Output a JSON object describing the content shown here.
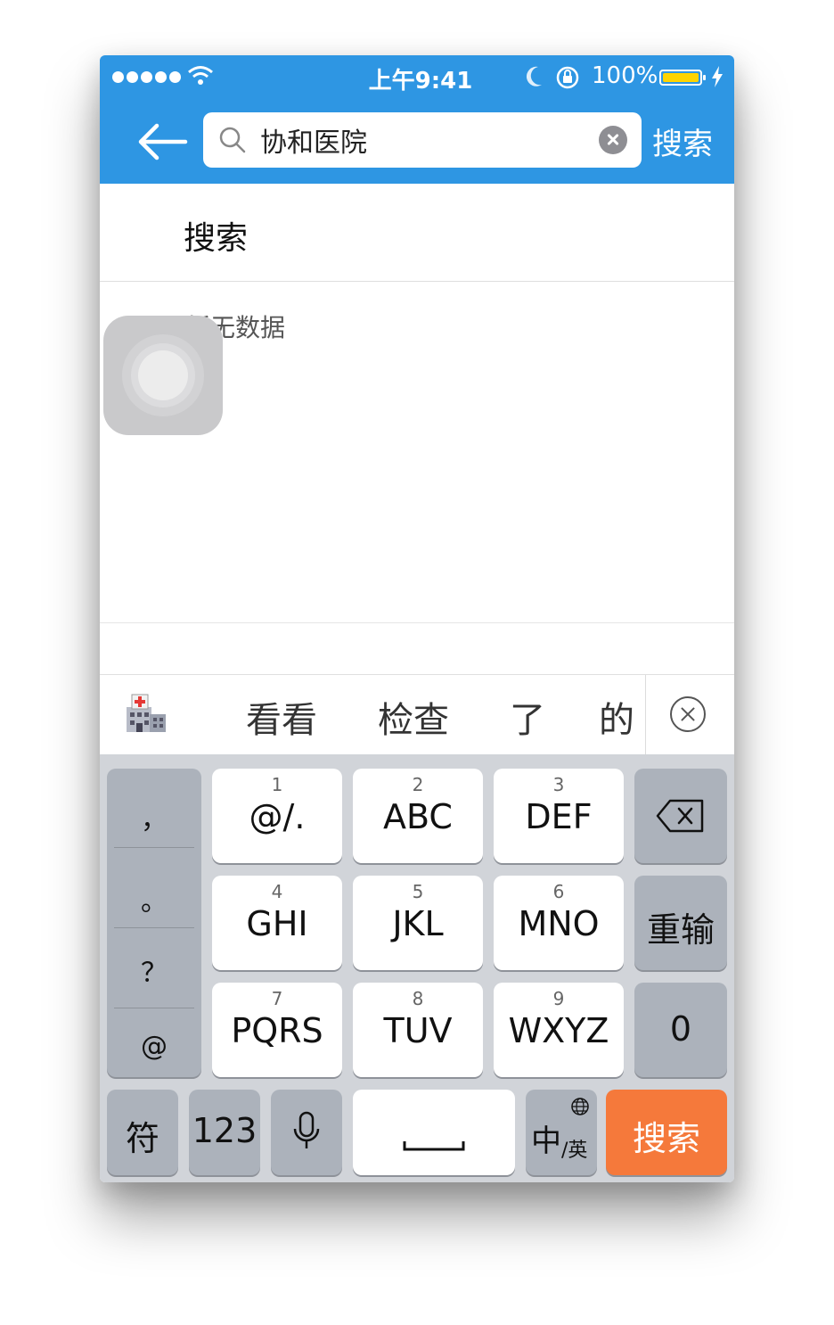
{
  "status_bar": {
    "time": "上午9:41",
    "battery": "100%"
  },
  "header": {
    "search_value": "协和医院",
    "search_button": "搜索"
  },
  "content": {
    "section_title": "搜索",
    "empty_message": "暂无数据"
  },
  "candidates": [
    "看看",
    "检查",
    "了",
    "的"
  ],
  "keyboard": {
    "punctuation": [
      "，",
      "。",
      "？",
      "@"
    ],
    "keys": [
      {
        "num": "1",
        "label": "@/."
      },
      {
        "num": "2",
        "label": "ABC"
      },
      {
        "num": "3",
        "label": "DEF"
      },
      {
        "num": "4",
        "label": "GHI"
      },
      {
        "num": "5",
        "label": "JKL"
      },
      {
        "num": "6",
        "label": "MNO"
      },
      {
        "num": "7",
        "label": "PQRS"
      },
      {
        "num": "8",
        "label": "TUV"
      },
      {
        "num": "9",
        "label": "WXYZ"
      }
    ],
    "reenter": "重输",
    "zero": "0",
    "symbols": "符",
    "numbers": "123",
    "lang_main": "中",
    "lang_sub": "/英",
    "search": "搜索"
  },
  "colors": {
    "header_blue": "#2e96e3",
    "search_orange": "#f5793b",
    "battery_yellow": "#ffd400"
  }
}
